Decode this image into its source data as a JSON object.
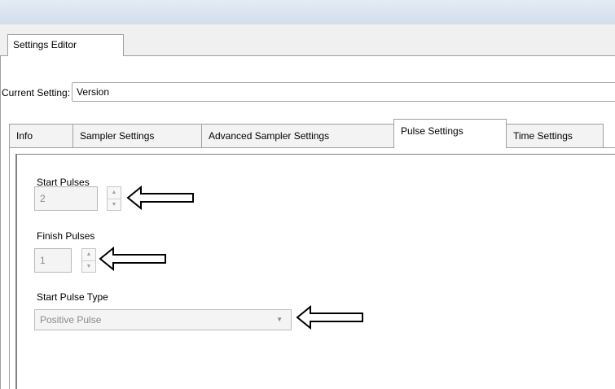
{
  "editor_tab": {
    "label": "Settings Editor"
  },
  "current_setting": {
    "label": "Current Setting:",
    "value": "Version"
  },
  "tabs": [
    {
      "label": "Info"
    },
    {
      "label": "Sampler Settings"
    },
    {
      "label": "Advanced Sampler Settings"
    },
    {
      "label": "Pulse Settings",
      "active": true
    },
    {
      "label": "Time Settings"
    }
  ],
  "pulse_settings": {
    "start_pulses": {
      "label": "Start Pulses",
      "value": "2"
    },
    "finish_pulses": {
      "label": "Finish Pulses",
      "value": "1"
    },
    "start_pulse_type": {
      "label": "Start Pulse Type",
      "value": "Positive Pulse"
    }
  },
  "icons": {
    "spinner_up": "chevron-up",
    "spinner_down": "chevron-down",
    "dropdown": "chevron-down",
    "callout": "left-arrow"
  }
}
